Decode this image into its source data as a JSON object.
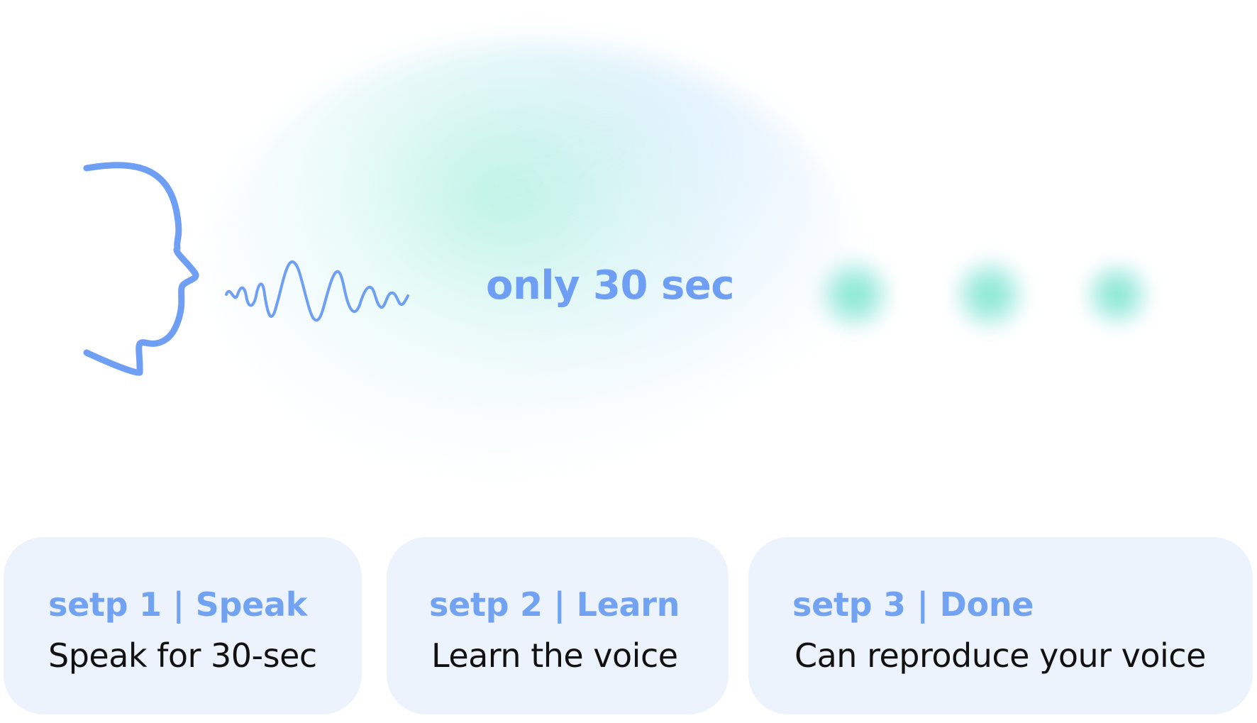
{
  "icons": {
    "head": "head-profile-icon",
    "wave": "sound-wave-icon"
  },
  "headline": "only 30 sec",
  "colors": {
    "accent": "#6f9ff5",
    "card_bg": "#edf3fd",
    "glow": "#a0f0d6",
    "text": "#111111"
  },
  "steps": [
    {
      "title": "setp 1 |  Speak",
      "description": "Speak for 30-sec"
    },
    {
      "title": "setp 2 |  Learn",
      "description": "Learn the voice"
    },
    {
      "title": "setp 3 | Done",
      "description": "Can reproduce your voice"
    }
  ]
}
